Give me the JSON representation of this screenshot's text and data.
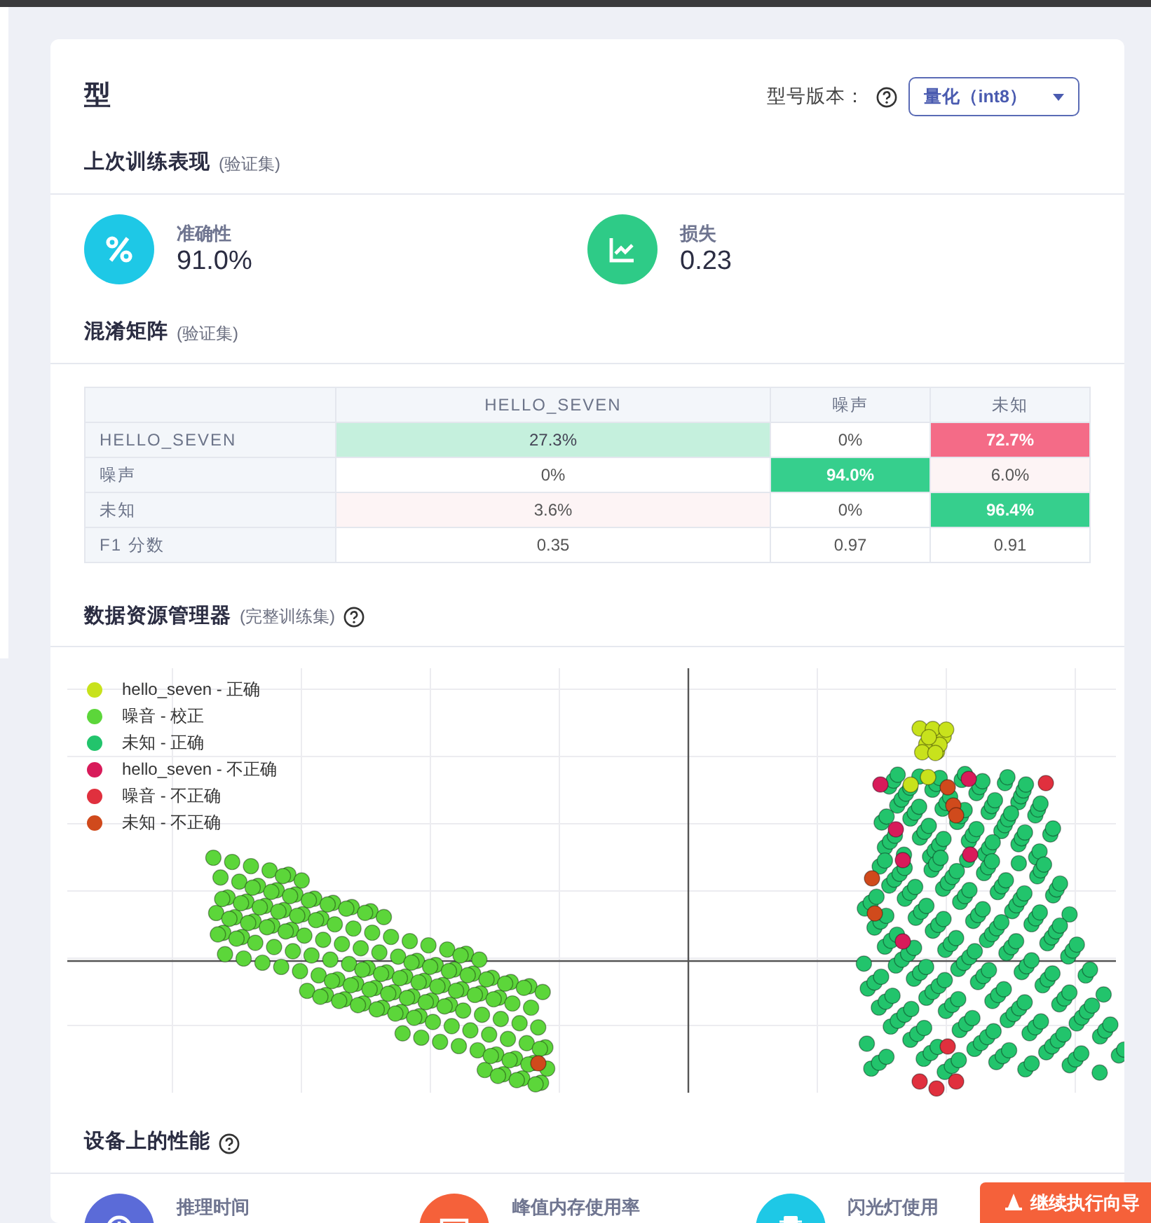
{
  "page_title": "型",
  "model_version": {
    "label": "型号版本：",
    "value": "量化（int8）"
  },
  "performance": {
    "title": "上次训练表现",
    "note": "(验证集)",
    "metrics": [
      {
        "kind": "accuracy",
        "label": "准确性",
        "value": "91.0%"
      },
      {
        "kind": "loss",
        "label": "损失",
        "value": "0.23"
      }
    ]
  },
  "confusion_matrix": {
    "title": "混淆矩阵",
    "note": "(验证集)",
    "columns": [
      "HELLO_SEVEN",
      "噪声",
      "未知"
    ],
    "rows": [
      {
        "label": "HELLO_SEVEN",
        "cells": [
          {
            "text": "27.3%",
            "kind": "good-light"
          },
          {
            "text": "0%",
            "kind": "plain"
          },
          {
            "text": "72.7%",
            "kind": "bad-strong"
          }
        ]
      },
      {
        "label": "噪声",
        "cells": [
          {
            "text": "0%",
            "kind": "plain"
          },
          {
            "text": "94.0%",
            "kind": "good-strong"
          },
          {
            "text": "6.0%",
            "kind": "bad-light"
          }
        ]
      },
      {
        "label": "未知",
        "cells": [
          {
            "text": "3.6%",
            "kind": "bad-light"
          },
          {
            "text": "0%",
            "kind": "plain"
          },
          {
            "text": "96.4%",
            "kind": "good-strong"
          }
        ]
      },
      {
        "label": "F1 分数",
        "cells": [
          {
            "text": "0.35",
            "kind": "plain"
          },
          {
            "text": "0.97",
            "kind": "plain"
          },
          {
            "text": "0.91",
            "kind": "plain"
          }
        ]
      }
    ]
  },
  "data_explorer": {
    "title": "数据资源管理器",
    "note": "(完整训练集)",
    "legend": [
      {
        "label": "hello_seven - 正确",
        "color": "#c8e21c"
      },
      {
        "label": "噪音 - 校正",
        "color": "#5cd63a"
      },
      {
        "label": "未知 - 正确",
        "color": "#22c46c"
      },
      {
        "label": "hello_seven - 不正确",
        "color": "#d81b5a"
      },
      {
        "label": "噪音 - 不正确",
        "color": "#e0303e"
      },
      {
        "label": "未知 - 不正确",
        "color": "#d04a1c"
      }
    ]
  },
  "on_device": {
    "title": "设备上的性能",
    "metrics": [
      {
        "kind": "time",
        "label": "推理时间"
      },
      {
        "kind": "memory",
        "label": "峰值内存使用率"
      },
      {
        "kind": "flash",
        "label": "闪光灯使用"
      }
    ]
  },
  "wizard_button": "继续执行向导"
}
